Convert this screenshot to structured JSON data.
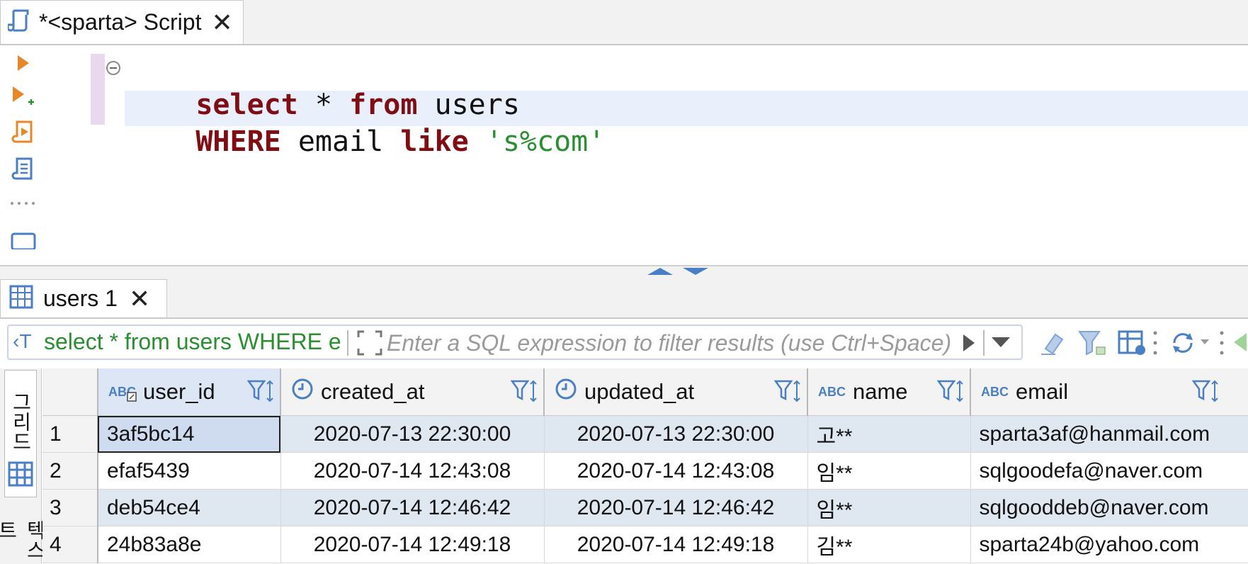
{
  "editor_tab": {
    "title": "*<sparta> Script"
  },
  "editor": {
    "line1": {
      "kw1": "select",
      "sym": " * ",
      "kw2": "from",
      "tbl": " users"
    },
    "line2": {
      "kw1": "WHERE",
      "col": " email ",
      "kw2": "like",
      "str": " 's%com'"
    }
  },
  "result_tab": {
    "title": "users 1"
  },
  "toolbar": {
    "query_preview": "select * from users WHERE email like 's%com'",
    "filter_placeholder": "Enter a SQL expression to filter results (use Ctrl+Space)"
  },
  "side_tabs": {
    "grid": "그리드",
    "text": "텍스트"
  },
  "grid": {
    "columns": [
      {
        "name": "user_id",
        "type": "ABC"
      },
      {
        "name": "created_at",
        "type": "timestamp"
      },
      {
        "name": "updated_at",
        "type": "timestamp"
      },
      {
        "name": "name",
        "type": "ABC"
      },
      {
        "name": "email",
        "type": "ABC"
      }
    ],
    "rows": [
      {
        "num": "1",
        "user_id": "3af5bc14",
        "created_at": "2020-07-13 22:30:00",
        "updated_at": "2020-07-13 22:30:00",
        "name": "고**",
        "email": "sparta3af@hanmail.com"
      },
      {
        "num": "2",
        "user_id": "efaf5439",
        "created_at": "2020-07-14 12:43:08",
        "updated_at": "2020-07-14 12:43:08",
        "name": "임**",
        "email": "sqlgoodefa@naver.com"
      },
      {
        "num": "3",
        "user_id": "deb54ce4",
        "created_at": "2020-07-14 12:46:42",
        "updated_at": "2020-07-14 12:46:42",
        "name": "임**",
        "email": "sqlgooddeb@naver.com"
      },
      {
        "num": "4",
        "user_id": "24b83a8e",
        "created_at": "2020-07-14 12:49:18",
        "updated_at": "2020-07-14 12:49:18",
        "name": "김**",
        "email": "sparta24b@yahoo.com"
      }
    ]
  },
  "colors": {
    "keyword": "#7f0d13",
    "string": "#2a8f31",
    "icon_blue": "#4a7fc4",
    "run_orange": "#e8872a",
    "row_stripe": "#dfe7f1"
  }
}
